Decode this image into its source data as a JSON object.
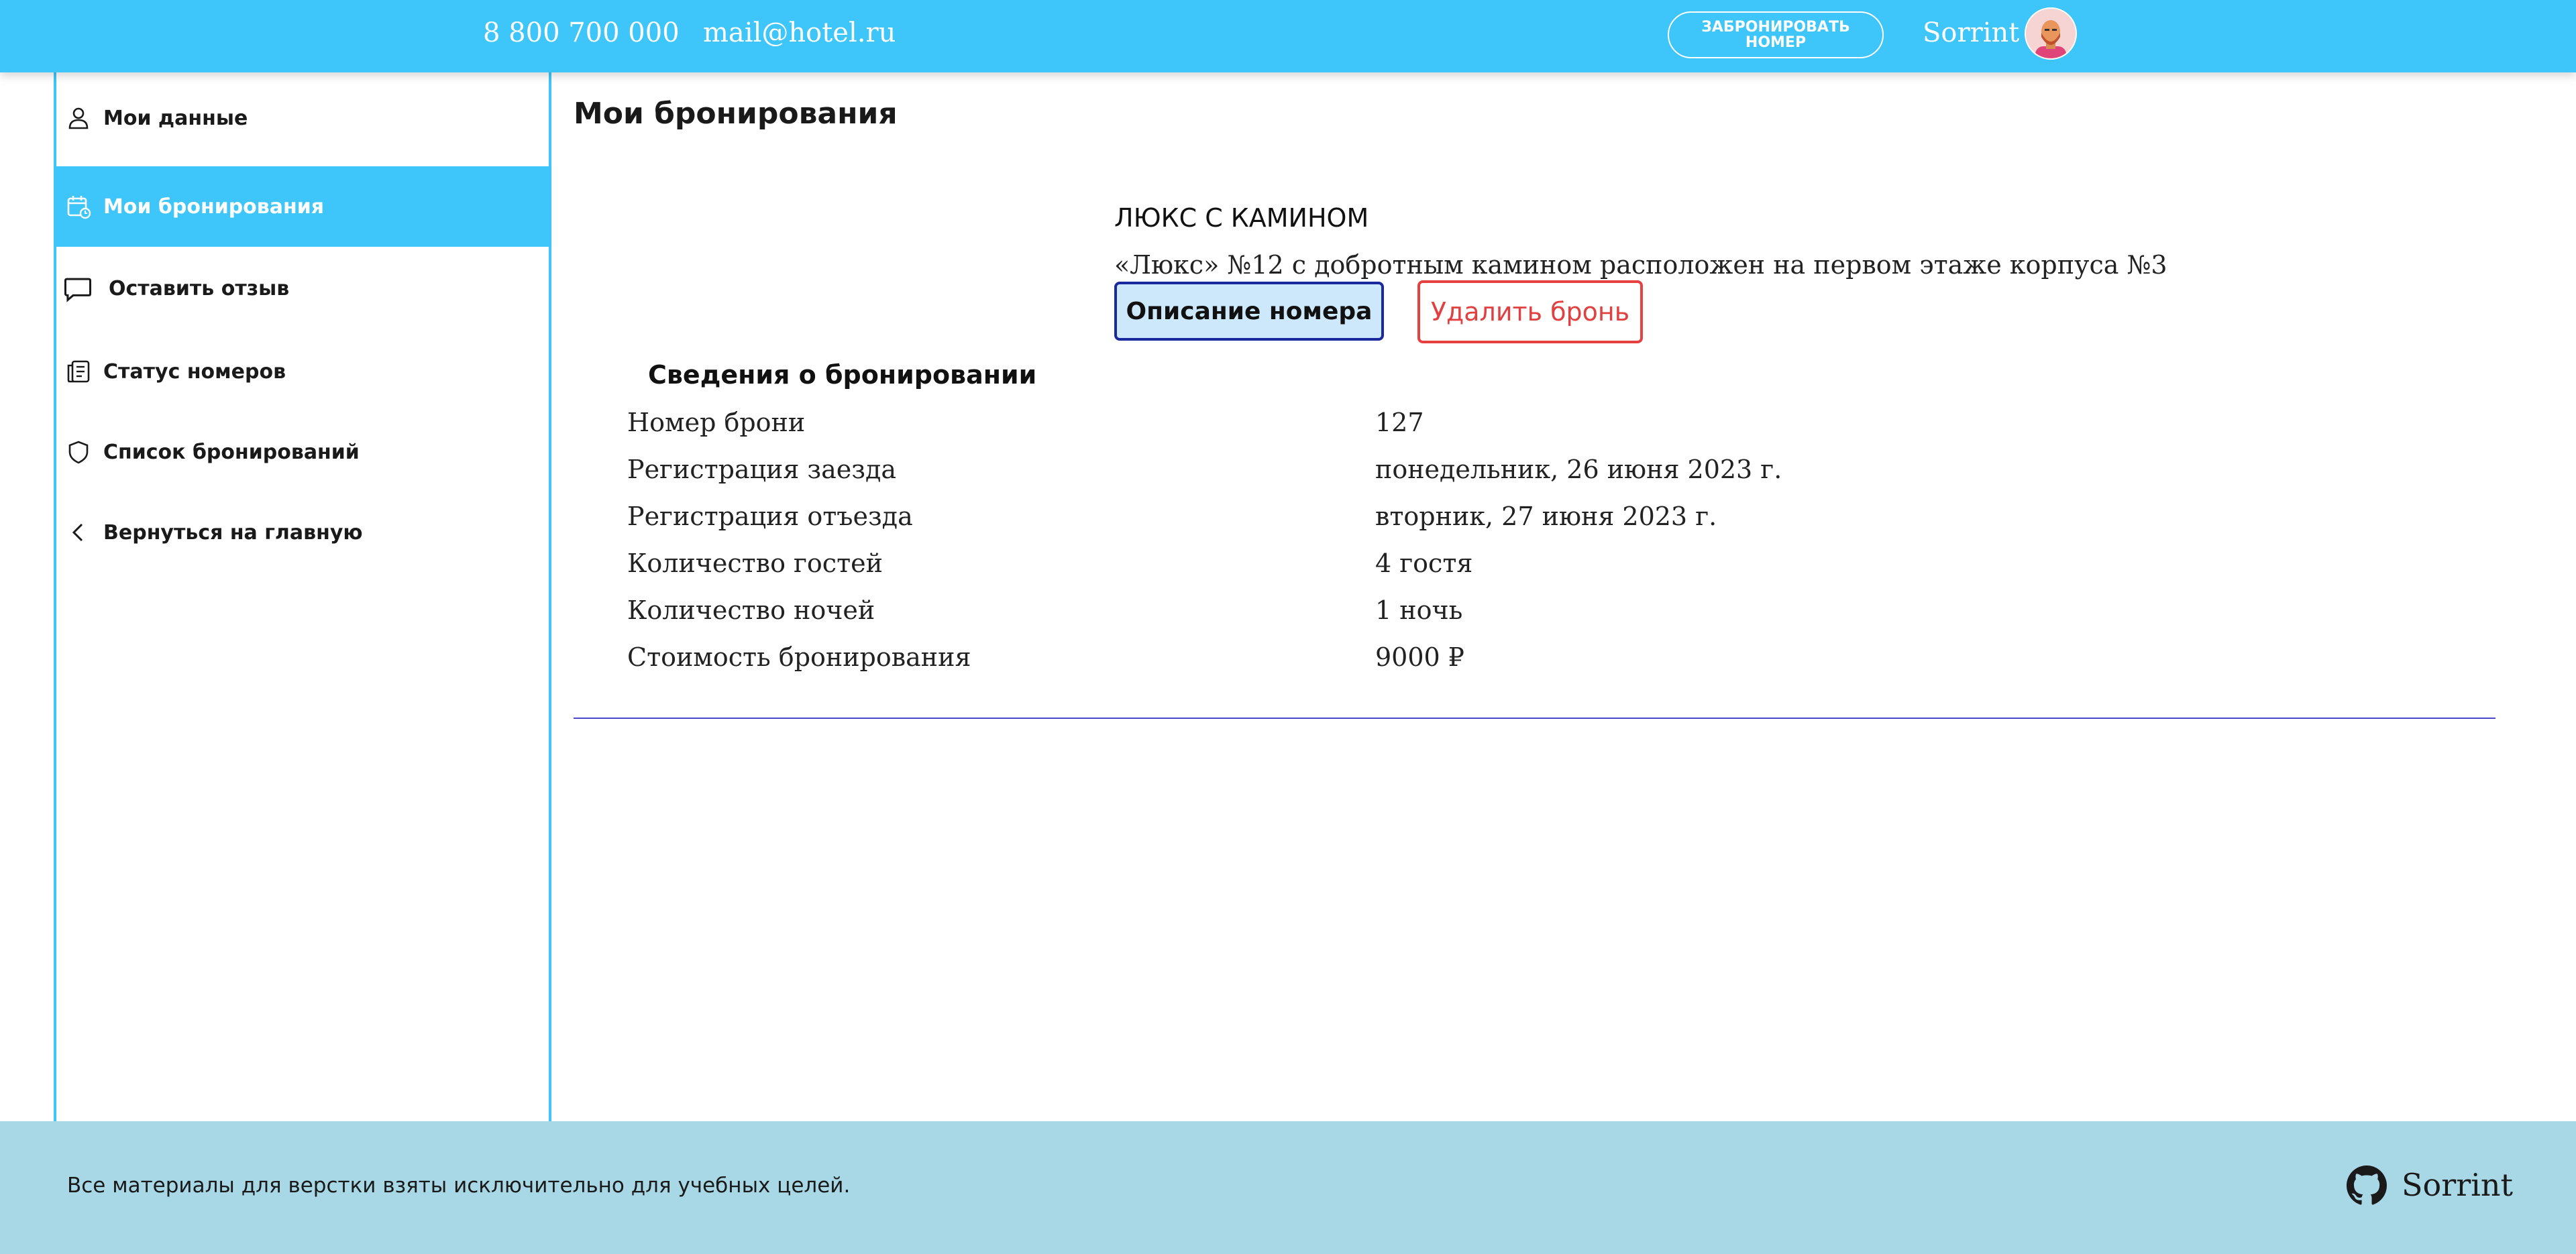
{
  "header": {
    "phone": "8 800 700 000",
    "email": "mail@hotel.ru",
    "book_button_line1": "ЗАБРОНИРОВАТЬ",
    "book_button_line2": "НОМЕР",
    "username": "Sorrint",
    "background_color": "#3ec5fa"
  },
  "sidebar": {
    "items": [
      {
        "label": "Мои данные",
        "icon": "user-icon",
        "active": false
      },
      {
        "label": "Мои бронирования",
        "icon": "calendar-icon",
        "active": true
      },
      {
        "label": "Оставить отзыв",
        "icon": "chat-bubble-icon",
        "active": false
      },
      {
        "label": "Статус номеров",
        "icon": "document-list-icon",
        "active": false
      },
      {
        "label": "Список бронирований",
        "icon": "shield-icon",
        "active": false
      },
      {
        "label": "Вернуться на главную",
        "icon": "chevron-left-icon",
        "active": false
      }
    ]
  },
  "main": {
    "title": "Мои бронирования",
    "booking": {
      "room_title": "ЛЮКС С КАМИНОМ",
      "room_description": "«Люкс» №12 с добротным камином расположен на первом этаже корпуса №3",
      "description_button": "Описание номера",
      "delete_button": "Удалить бронь",
      "details_heading": "Сведения о бронировании",
      "details": [
        {
          "label": "Номер брони",
          "value": "127"
        },
        {
          "label": "Регистрация заезда",
          "value": "понедельник, 26 июня 2023 г."
        },
        {
          "label": "Регистрация отъезда",
          "value": "вторник, 27 июня 2023 г."
        },
        {
          "label": "Количество гостей",
          "value": "4 гостя"
        },
        {
          "label": "Количество ночей",
          "value": "1 ночь"
        },
        {
          "label": "Стоимость бронирования",
          "value": "9000 ₽"
        }
      ]
    }
  },
  "footer": {
    "text": "Все материалы для верстки взяты исключительно для учебных целей.",
    "github_name": "Sorrint",
    "github_icon": "github-icon",
    "background_color": "#a8d8e6"
  }
}
